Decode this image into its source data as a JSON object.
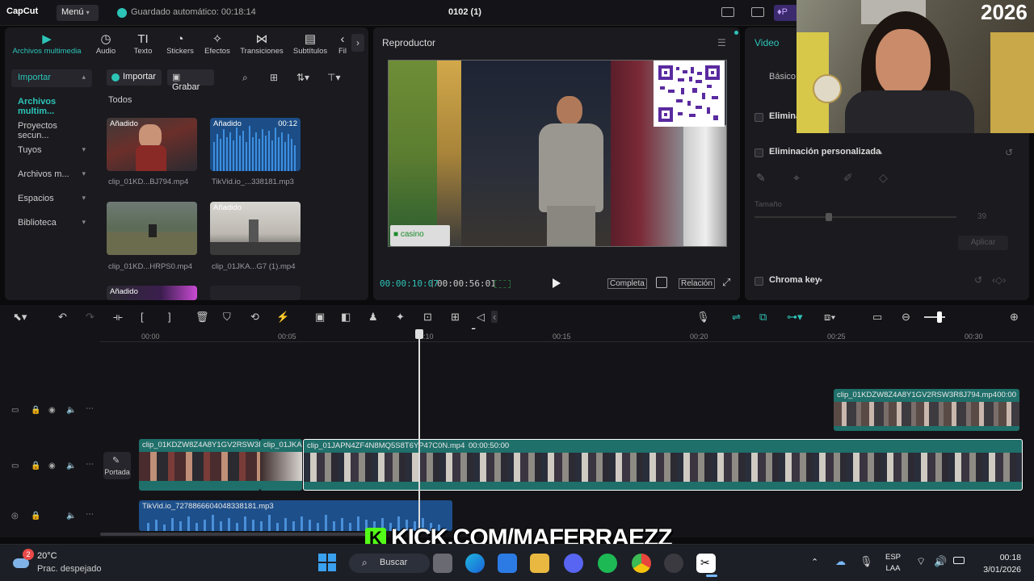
{
  "app": {
    "logo": "CapCut",
    "menu_label": "Menú",
    "autosave": "Guardado automático: 00:18:14",
    "project_name": "0102 (1)"
  },
  "media_tabs": [
    {
      "label": "Archivos multimedia",
      "icon": "media-icon",
      "active": true
    },
    {
      "label": "Audio",
      "icon": "audio-icon"
    },
    {
      "label": "Texto",
      "icon": "text-icon"
    },
    {
      "label": "Stickers",
      "icon": "sticker-icon"
    },
    {
      "label": "Efectos",
      "icon": "effects-icon"
    },
    {
      "label": "Transiciones",
      "icon": "transitions-icon"
    },
    {
      "label": "Subtítulos",
      "icon": "subtitles-icon"
    },
    {
      "label": "Fil",
      "icon": "filters-icon"
    }
  ],
  "side_nav": [
    {
      "label": "Importar",
      "chev": "▴"
    },
    {
      "label": "Archivos multim...",
      "chev": ""
    },
    {
      "label": "Proyectos secun...",
      "chev": ""
    },
    {
      "label": "Tuyos",
      "chev": "▾"
    },
    {
      "label": "Archivos m...",
      "chev": "▾"
    },
    {
      "label": "Espacios",
      "chev": "▾"
    },
    {
      "label": "Biblioteca",
      "chev": "▾"
    }
  ],
  "media_toolbar": {
    "import_label": "Importar",
    "record_label": "Grabar"
  },
  "media_section_title": "Todos",
  "media_items": [
    {
      "tag": "Añadido",
      "duration": "",
      "caption": "clip_01KD...BJ794.mp4"
    },
    {
      "tag": "Añadido",
      "duration": "00:12",
      "caption": "TikVid.io_...338181.mp3"
    },
    {
      "tag": "",
      "duration": "",
      "caption": "clip_01KD...HRPS0.mp4"
    },
    {
      "tag": "Añadido",
      "duration": "",
      "caption": "clip_01JKA...G7 (1).mp4"
    },
    {
      "tag": "Añadido",
      "duration": "",
      "caption": ""
    }
  ],
  "player": {
    "title": "Reproductor",
    "current_time": "00:00:10:07",
    "total_time": "00:00:56:01",
    "full_label": "Completa",
    "ratio_label": "Relación",
    "overlay_text": "casino"
  },
  "right_panel": {
    "tab": "Video",
    "subtab": "Básico",
    "option1": "Eliminar",
    "option2": "Eliminación personalizada",
    "size_label": "Tamaño",
    "size_value": "39",
    "apply_label": "Aplicar",
    "option3": "Chroma key"
  },
  "webcam": {
    "year_text": "2026"
  },
  "ruler": [
    "00:00",
    "00:05",
    "00:10",
    "00:15",
    "00:20",
    "00:25",
    "00:30"
  ],
  "tracks": {
    "cover_label": "Portada",
    "clip_top": "clip_01KDZW8Z4A8Y1GV2RSW3R8J794.mp4",
    "clip_top_dur": "00:00",
    "clip_main_a": "clip_01KDZW8Z4A8Y1GV2RSW3R",
    "clip_main_b": "clip_01JKA",
    "clip_main_c": "clip_01JAPN4ZF4N8MQ5S8T6YP47C0N.mp4",
    "clip_main_c_dur": "00:00:50:00",
    "clip_audio": "TikVid.io_7278866604048338181.mp3"
  },
  "watermark": {
    "k": "K",
    "text": "KICK.COM/MAFERRAEZZ"
  },
  "taskbar": {
    "temp": "20°C",
    "weather": "Prac. despejado",
    "search": "Buscar",
    "lang1": "ESP",
    "lang2": "LAA",
    "time": "00:18",
    "date": "3/01/2026",
    "notif_count": "2"
  },
  "colors": {
    "accent": "#2dc4b8",
    "clip_teal": "#1f6f6a",
    "audio_blue": "#1d4f8a",
    "kick_green": "#53fc18"
  }
}
